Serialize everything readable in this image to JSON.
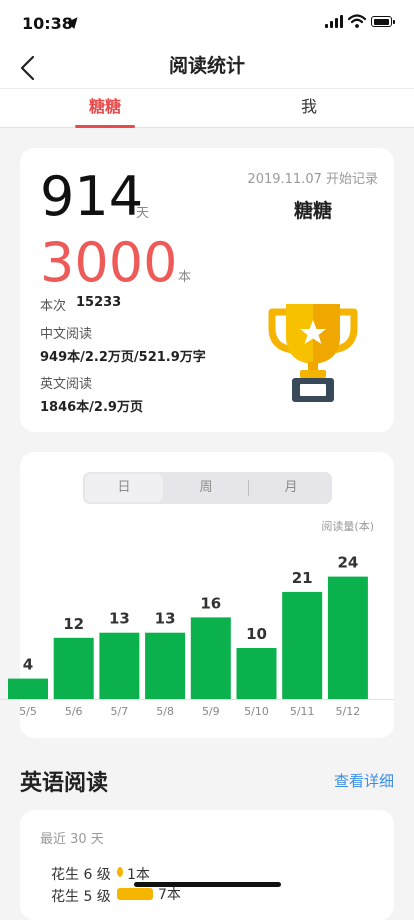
{
  "status_bar": {
    "time": "10:38"
  },
  "nav": {
    "title": "阅读统计"
  },
  "tabs": [
    {
      "label": "糖糖"
    },
    {
      "label": "我"
    }
  ],
  "summary": {
    "days": "914",
    "days_unit": "天",
    "books": "3000",
    "books_unit": "本",
    "since": "2019.11.07 开始记录",
    "name": "糖糖",
    "session_label": "本次",
    "session_value": "15233",
    "chinese_label": "中文阅读",
    "chinese_value": "949本/2.2万页/521.9万字",
    "english_label": "英文阅读",
    "english_value": "1846本/2.9万页"
  },
  "period_selector": {
    "options": [
      "日",
      "周",
      "月"
    ],
    "selected": "日"
  },
  "chart_data": {
    "type": "bar",
    "ylabel": "阅读量(本)",
    "categories": [
      "5/5",
      "5/6",
      "5/7",
      "5/8",
      "5/9",
      "5/10",
      "5/11",
      "5/12"
    ],
    "values": [
      4,
      12,
      13,
      13,
      16,
      10,
      21,
      24
    ],
    "color": "#0bb14c"
  },
  "english_section": {
    "title": "英语阅读",
    "more": "查看详细",
    "period": "最近 30 天",
    "levels": [
      {
        "label": "花生 6 级",
        "value": "1本"
      },
      {
        "label": "花生 5 级",
        "value": "7本"
      }
    ]
  },
  "colors": {
    "accent": "#e84b4b",
    "books": "#ee5a58",
    "link": "#3b8ee8",
    "bar": "#0bb14c",
    "level": "#f6b500"
  }
}
